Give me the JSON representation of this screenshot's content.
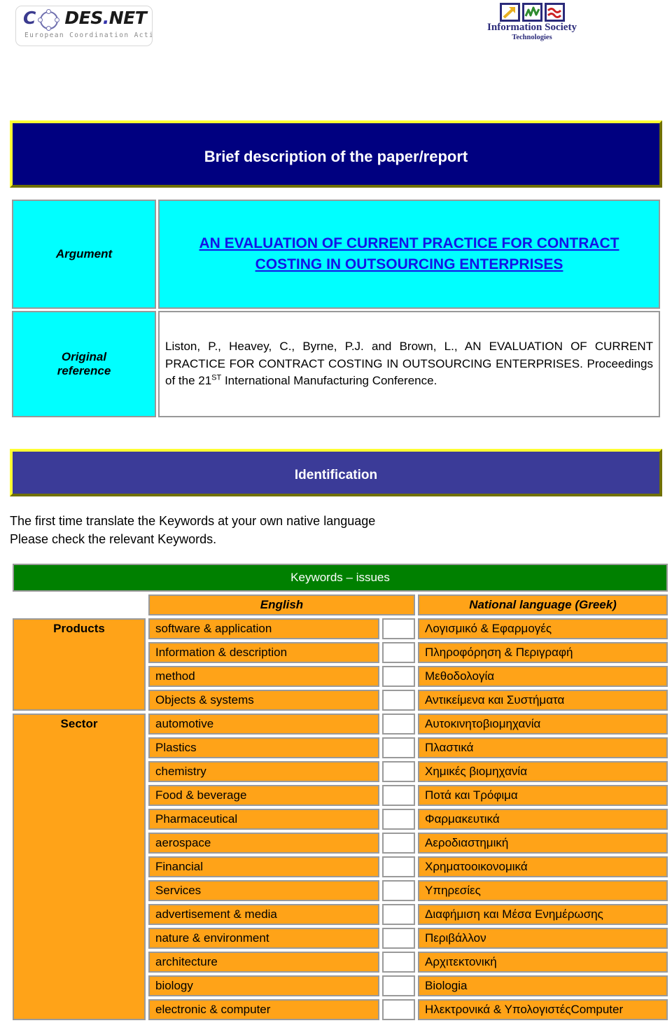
{
  "header": {
    "codes_logo": {
      "name": "CODES.NET",
      "word_part1": "C",
      "word_part2": "DES",
      "dot": ".",
      "word_part3": "NET",
      "tagline": "European Coordination Action"
    },
    "ist_logo": {
      "title": "Information Society",
      "subtitle": "Technologies",
      "icons": [
        "arrow-up-right-icon",
        "zigzag-chart-icon",
        "wave-lines-icon"
      ],
      "icon_colors": [
        "#e8b021",
        "#2e8b2e",
        "#cc2222"
      ],
      "frame_color": "#2b2b7a"
    }
  },
  "banners": {
    "title": "Brief description of the paper/report",
    "title_bg": "#000080",
    "identification": "Identification",
    "identification_bg": "#3b3b98",
    "border_light": "#ffff33",
    "border_dark": "#707000"
  },
  "info": {
    "argument_label": "Argument",
    "argument_title": "AN EVALUATION OF CURRENT PRACTICE FOR CONTRACT COSTING IN OUTSOURCING ENTERPRISES",
    "reference_label_line1": "Original",
    "reference_label_line2": "reference",
    "reference_text_part1": "Liston, P., Heavey, C., Byrne, P.J. and Brown, L., AN EVALUATION OF CURRENT PRACTICE FOR CONTRACT COSTING IN OUTSOURCING ENTERPRISES. Proceedings of the 21",
    "reference_superscript": "ST",
    "reference_text_part2": " International Manufacturing Conference.",
    "label_bg": "#00ffff",
    "title_color": "#1414e6"
  },
  "instructions": {
    "line1": "The first time translate the Keywords at your own native language",
    "line2": "Please check the relevant Keywords."
  },
  "keywords": {
    "header": "Keywords – issues",
    "header_bg": "#008000",
    "col_english": "English",
    "col_national": "National  language (Greek)",
    "row_bg": "#ffa318",
    "groups": [
      {
        "label": "Products",
        "rows": [
          {
            "english": "software & application",
            "greek": "Λογισμικό & Εφαρμογές",
            "checked": false
          },
          {
            "english": "Information & description",
            "greek": "Πληροφόρηση & Περιγραφή",
            "checked": false
          },
          {
            "english": "method",
            "greek": "Μεθοδολογία",
            "checked": false
          },
          {
            "english": "Objects & systems",
            "greek": "Αντικείμενα και Συστήματα",
            "checked": false
          }
        ]
      },
      {
        "label": "Sector",
        "rows": [
          {
            "english": "automotive",
            "greek": "Αυτοκινητοβιομηχανία",
            "checked": false
          },
          {
            "english": "Plastics",
            "greek": "Πλαστικά",
            "checked": false
          },
          {
            "english": "chemistry",
            "greek": "Χημικές βιομηχανία",
            "checked": false
          },
          {
            "english": "Food & beverage",
            "greek": "Ποτά και Τρόφιμα",
            "checked": false
          },
          {
            "english": "Pharmaceutical",
            "greek": "Φαρμακευτικά",
            "checked": false
          },
          {
            "english": "aerospace",
            "greek": "Αεροδιαστημική",
            "checked": false
          },
          {
            "english": "Financial",
            "greek": "Χρηματοοικονομικά",
            "checked": false
          },
          {
            "english": "Services",
            "greek": "Υπηρεσίες",
            "checked": false
          },
          {
            "english": "advertisement & media",
            "greek": "Διαφήμιση και Μέσα Ενημέρωσης",
            "checked": false
          },
          {
            "english": "nature & environment",
            "greek": "Περιβάλλον",
            "checked": false
          },
          {
            "english": "architecture",
            "greek": "Αρχιτεκτονική",
            "checked": false
          },
          {
            "english": "biology",
            "greek": "Biologia",
            "checked": false
          },
          {
            "english": "electronic & computer",
            "greek": "Ηλεκτρονικά & ΥπολογιστέςComputer",
            "checked": false
          }
        ]
      }
    ]
  }
}
